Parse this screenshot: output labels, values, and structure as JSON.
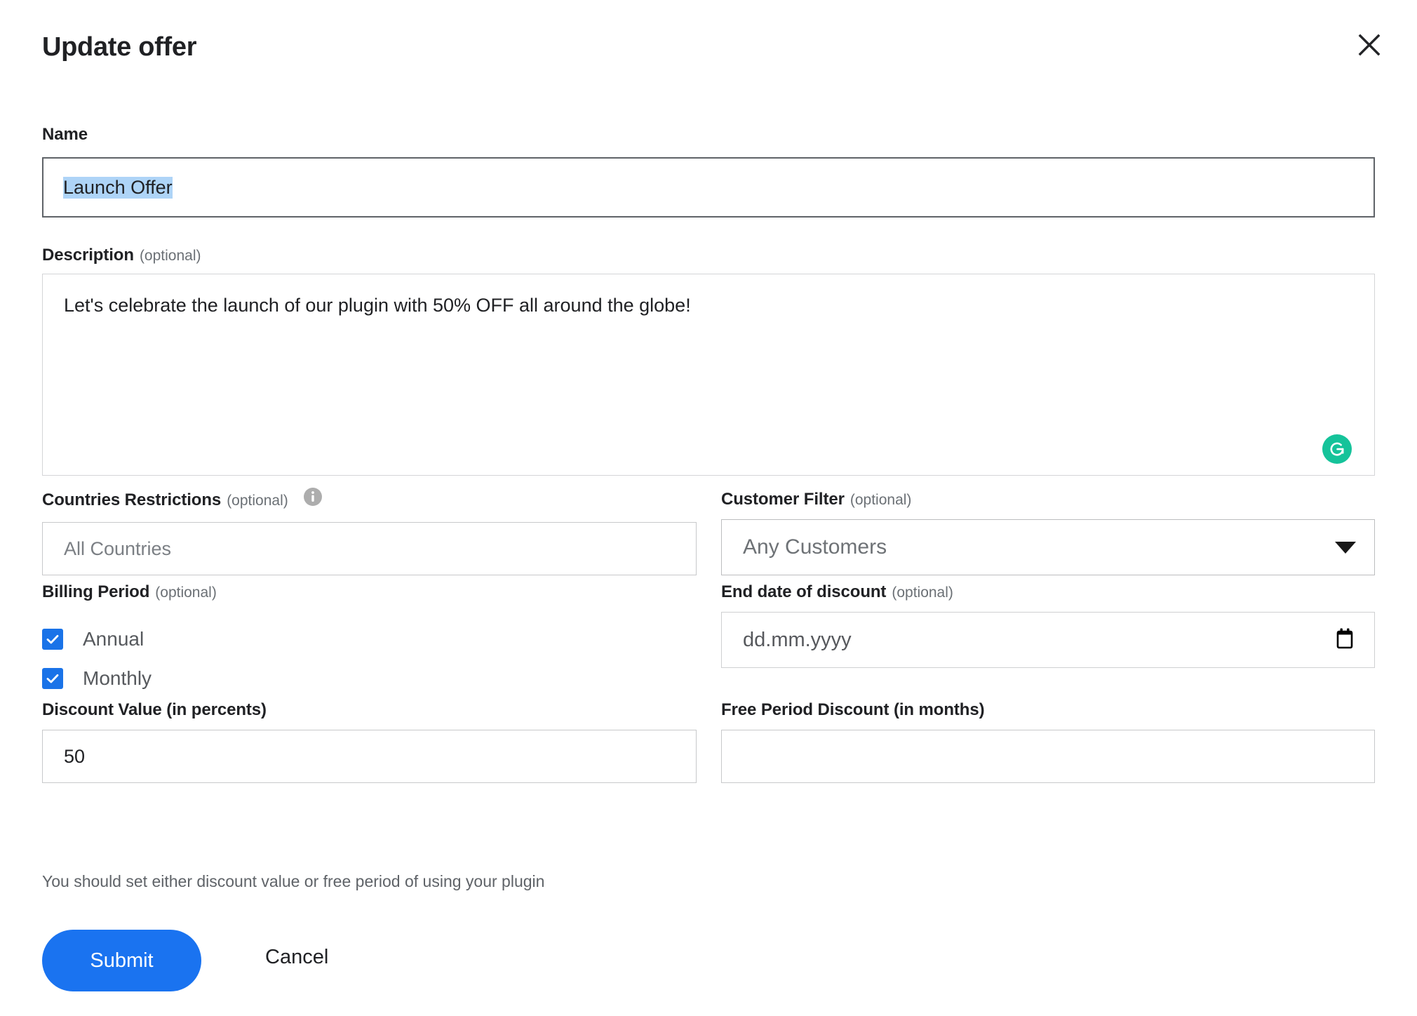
{
  "dialog": {
    "title": "Update offer",
    "close_icon": "close-icon"
  },
  "fields": {
    "name": {
      "label": "Name",
      "value": "Launch Offer",
      "selected": true
    },
    "description": {
      "label": "Description",
      "optional": "(optional)",
      "value": "Let's celebrate the launch of our plugin with 50% OFF all around the globe!",
      "assistant_icon": "grammarly-icon"
    },
    "countries_restrictions": {
      "label": "Countries Restrictions",
      "optional": "(optional)",
      "placeholder": "All Countries",
      "value": "",
      "info_icon": "info-icon"
    },
    "customer_filter": {
      "label": "Customer Filter",
      "optional": "(optional)",
      "selected_option": "Any Customers",
      "caret_icon": "chevron-down-icon"
    },
    "billing_period": {
      "label": "Billing Period",
      "optional": "(optional)",
      "options": [
        {
          "label": "Annual",
          "checked": true
        },
        {
          "label": "Monthly",
          "checked": true
        }
      ]
    },
    "end_date_of_discount": {
      "label": "End date of discount",
      "optional": "(optional)",
      "placeholder": "dd.mm.yyyy",
      "value": "",
      "calendar_icon": "calendar-icon"
    },
    "discount_value": {
      "label": "Discount Value (in percents)",
      "value": "50",
      "helper_text": "You should set either discount value or free period of using your plugin"
    },
    "free_period_discount": {
      "label": "Free Period Discount (in months)",
      "value": "",
      "placeholder": ""
    }
  },
  "actions": {
    "submit_label": "Submit",
    "cancel_label": "Cancel"
  },
  "colors": {
    "accent_blue": "#1a73f0",
    "checkbox_blue": "#1a73e8",
    "selection_blue": "#aed4f7",
    "grammarly_green": "#15c39a",
    "text_primary": "#202124",
    "text_muted": "#6b7075",
    "border": "#c8c9cb"
  }
}
